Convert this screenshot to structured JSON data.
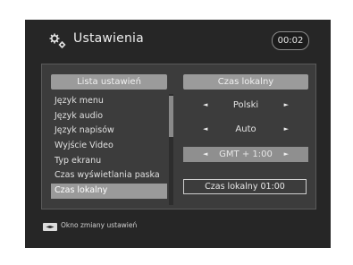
{
  "header": {
    "title": "Ustawienia",
    "clock": "00:02",
    "icon": "gears-icon"
  },
  "settings_list": {
    "header": "Lista ustawień",
    "items": [
      "Język menu",
      "Język audio",
      "Język napisów",
      "Wyjście Video",
      "Typ ekranu",
      "Czas wyświetlania paska",
      "Czas lokalny"
    ],
    "selected_index": 6
  },
  "detail": {
    "header": "Czas lokalny",
    "options": [
      {
        "value": "Polski",
        "left_arrow": "◄",
        "right_arrow": "►"
      },
      {
        "value": "Auto",
        "left_arrow": "◄",
        "right_arrow": "►"
      },
      {
        "value": "GMT + 1:00",
        "left_arrow": "◄",
        "right_arrow": "►"
      }
    ],
    "status": "Czas lokalny 01:00"
  },
  "footer": {
    "key_icon": "left-right-arrows-key-icon",
    "key_label": "◄►",
    "text": "Okno zmiany ustawień"
  },
  "colors": {
    "background": "#262626",
    "panel": "#3c3c3c",
    "highlight": "#9a9a9a"
  }
}
